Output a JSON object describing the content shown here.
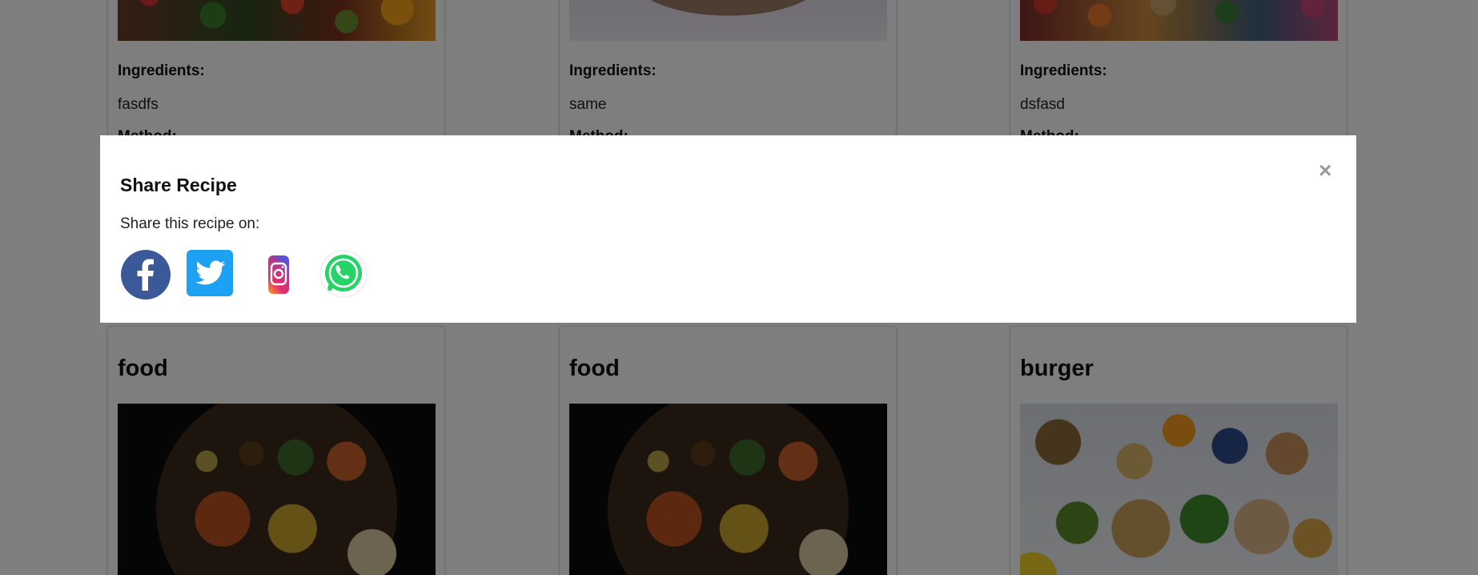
{
  "cards_top": [
    {
      "ingredients_label": "Ingredients:",
      "ingredients": "fasdfs",
      "method_label": "Method:",
      "image": "vegetables-photo"
    },
    {
      "ingredients_label": "Ingredients:",
      "ingredients": "same",
      "method_label": "Method:",
      "image": "wrap-photo"
    },
    {
      "ingredients_label": "Ingredients:",
      "ingredients": "dsfasd",
      "method_label": "Method:",
      "image": "fruit-photo"
    }
  ],
  "cards_bottom": [
    {
      "title": "food",
      "image": "indian-dishes-photo"
    },
    {
      "title": "food",
      "image": "indian-dishes-photo"
    },
    {
      "title": "burger",
      "image": "healthy-food-photo"
    }
  ],
  "modal": {
    "title": "Share Recipe",
    "text": "Share this recipe on:",
    "close_label": "×",
    "icons": [
      {
        "name": "facebook-icon",
        "color": "#3b5998"
      },
      {
        "name": "twitter-icon",
        "color": "#1da1f2"
      },
      {
        "name": "instagram-icon",
        "color": "#c13584"
      },
      {
        "name": "whatsapp-icon",
        "color": "#25d366"
      }
    ]
  },
  "colors": {
    "overlay": "rgba(0,0,0,0.5)",
    "modal_bg": "#ffffff",
    "close": "#9a9a9a"
  }
}
